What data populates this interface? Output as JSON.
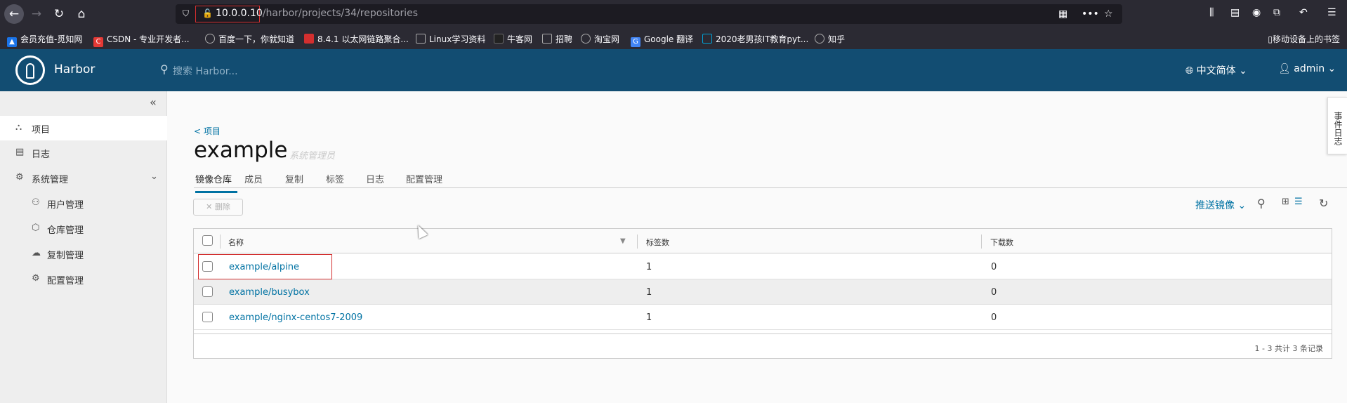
{
  "browser": {
    "url_host": "10.0.0.10",
    "url_path": "/harbor/projects/34/repositories",
    "bookmarks": [
      {
        "label": "会员充值-觅知网",
        "icon": "mountain-icon",
        "color": "#1a73e8"
      },
      {
        "label": "CSDN - 专业开发者...",
        "icon": "csdn-icon",
        "color": "#e53935"
      },
      {
        "label": "百度一下，你就知道",
        "icon": "globe-icon",
        "color": "#888888"
      },
      {
        "label": "8.4.1 以太网链路聚合...",
        "icon": "book-icon",
        "color": "#d32f2f"
      },
      {
        "label": "Linux学习资料",
        "icon": "folder-icon",
        "color": "#aaaaaa"
      },
      {
        "label": "牛客网",
        "icon": "nowcoder-icon",
        "color": "#222222"
      },
      {
        "label": "招聘",
        "icon": "folder-icon",
        "color": "#aaaaaa"
      },
      {
        "label": "淘宝网",
        "icon": "globe-icon",
        "color": "#888888"
      },
      {
        "label": "Google 翻译",
        "icon": "translate-icon",
        "color": "#4285f4"
      },
      {
        "label": "2020老男孩IT教育pyt...",
        "icon": "bilibili-icon",
        "color": "#00a1d6"
      },
      {
        "label": "知乎",
        "icon": "globe-icon",
        "color": "#888888"
      }
    ],
    "mobile_bookmarks": "移动设备上的书签"
  },
  "header": {
    "brand": "Harbor",
    "search_placeholder": "搜索 Harbor...",
    "language": "中文简体",
    "user": "admin",
    "accent": "#124d72"
  },
  "sidebar": {
    "items": [
      {
        "label": "项目",
        "icon": "projects-icon",
        "active": true
      },
      {
        "label": "日志",
        "icon": "logs-icon",
        "active": false
      },
      {
        "label": "系统管理",
        "icon": "admin-icon",
        "active": false
      }
    ],
    "sub_items": [
      {
        "label": "用户管理",
        "icon": "users-icon"
      },
      {
        "label": "仓库管理",
        "icon": "registry-icon"
      },
      {
        "label": "复制管理",
        "icon": "replication-icon"
      },
      {
        "label": "配置管理",
        "icon": "config-icon"
      }
    ]
  },
  "project": {
    "back_label": "< 项目",
    "name": "example",
    "role": "系统管理员",
    "tabs": [
      "镜像仓库",
      "成员",
      "复制",
      "标签",
      "日志",
      "配置管理"
    ],
    "active_tab": "镜像仓库"
  },
  "toolbar": {
    "delete_label": "删除",
    "push_label": "推送镜像"
  },
  "table": {
    "columns": [
      "名称",
      "标签数",
      "下载数"
    ],
    "rows": [
      {
        "name": "example/alpine",
        "tags": "1",
        "pulls": "0"
      },
      {
        "name": "example/busybox",
        "tags": "1",
        "pulls": "0"
      },
      {
        "name": "example/nginx-centos7-2009",
        "tags": "1",
        "pulls": "0"
      }
    ],
    "footer": "1 - 3 共计 3 条记录"
  },
  "event_log_tab": "事件日志"
}
